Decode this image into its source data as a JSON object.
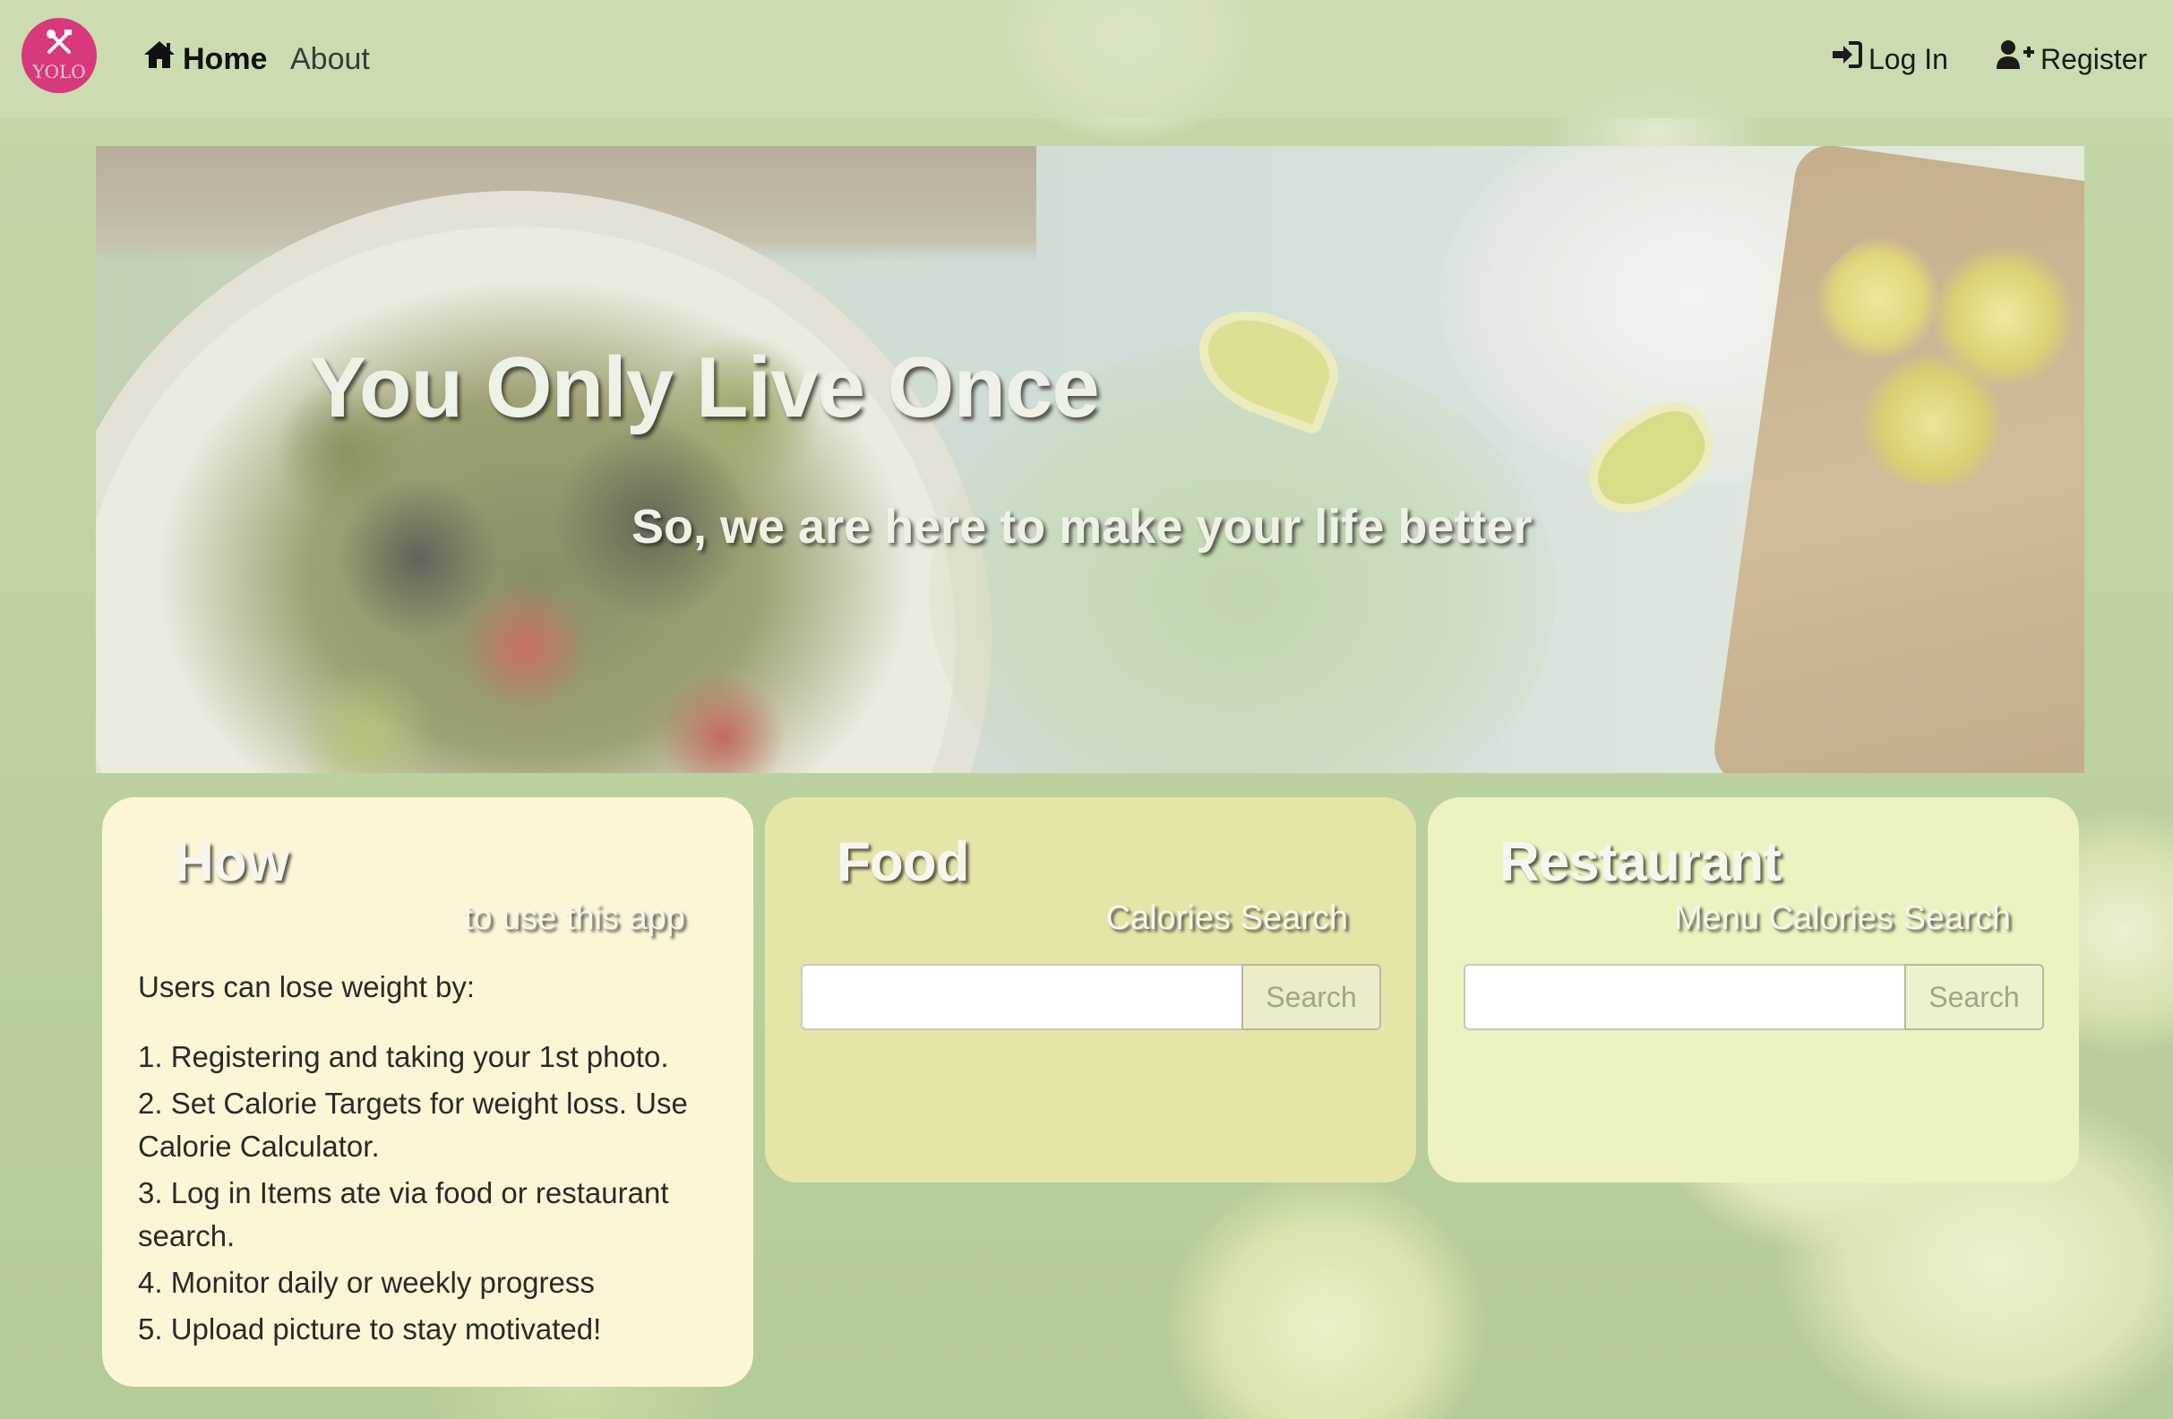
{
  "nav": {
    "logo_text": "YOLO",
    "home_label": "Home",
    "about_label": "About",
    "login_label": "Log In",
    "register_label": "Register"
  },
  "hero": {
    "title": "You Only Live Once",
    "subtitle": "So, we are here to make your life better"
  },
  "how_card": {
    "title": "How",
    "subtitle": "to use this app",
    "intro": "Users can lose weight by:",
    "steps": [
      "1. Registering and taking your 1st photo.",
      "2. Set Calorie Targets for weight loss. Use Calorie Calculator.",
      "3. Log in Items ate via food or restaurant search.",
      "4. Monitor daily or weekly progress",
      "5. Upload picture to stay motivated!"
    ]
  },
  "food_card": {
    "title": "Food",
    "subtitle": "Calories Search",
    "search_value": "",
    "search_button": "Search"
  },
  "restaurant_card": {
    "title": "Restaurant",
    "subtitle": "Menu Calories Search",
    "search_value": "",
    "search_button": "Search"
  },
  "colors": {
    "logo": "#d8397c",
    "how_card_bg": "#fdf6d6",
    "food_card_bg": "#e6e5a8",
    "restaurant_card_bg": "#eef2c0",
    "page_bg": "#b6cf9c"
  },
  "icons": {
    "logo": "utensils-icon",
    "home": "home-icon",
    "login": "sign-in-icon",
    "register": "user-plus-icon"
  }
}
